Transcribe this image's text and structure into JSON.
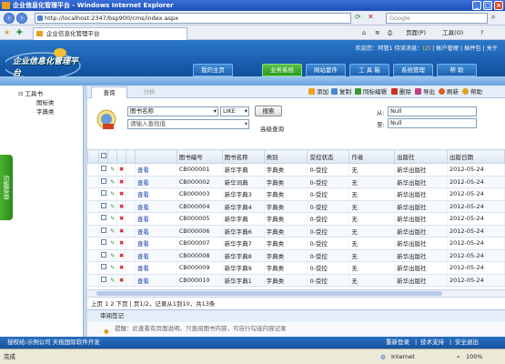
{
  "window": {
    "title": "企业信息化管理平台 - Windows Internet Explorer"
  },
  "browser": {
    "address": "http://localhost:2347/bsp900/cms/index.aspx",
    "search_placeholder": "Google",
    "tab_title": "企业信息化管理平台",
    "cmd_page": "页面(P)",
    "cmd_tools": "工具(O)",
    "status_left": "完成",
    "status_zone": "Internet",
    "zoom": "100%"
  },
  "app": {
    "logo_text": "企业信息化管理平台",
    "welcome": "欢迎您：阿管1 待读消息：",
    "welcome_count": "(2)",
    "links": [
      "账户管理",
      "插件包",
      "关于"
    ],
    "nav": [
      "我的主页",
      "业务系统",
      "网站套件",
      "工 具 箱",
      "系统管理",
      "帮 助"
    ],
    "nav_active": "业务系统"
  },
  "sidebar": {
    "root": "工具书",
    "children": [
      "图标类",
      "字典类"
    ],
    "tab_label": "功能菜单"
  },
  "query": {
    "tabs": [
      "查询",
      "分析"
    ],
    "tools": [
      "添加",
      "复制",
      "同标编辑",
      "删除",
      "导出",
      "刷新",
      "帮助"
    ],
    "field_select": "图书名称",
    "op_select": "LIKE",
    "search_button": "搜索",
    "keyword_placeholder": "请输入查找值",
    "advanced": "高级查询",
    "from_label": "从:",
    "from_value": "Null",
    "to_label": "至:",
    "to_value": "Null"
  },
  "table": {
    "columns": [
      "",
      "",
      "",
      "",
      "图书编号",
      "图书名称",
      "类别",
      "受控状态",
      "作者",
      "出版社",
      "出版日期"
    ],
    "view_label": "查看",
    "rows": [
      [
        "CB000001",
        "新华字典",
        "字典类",
        "0-受控",
        "无",
        "新华出版社",
        "2012-05-24"
      ],
      [
        "CB000002",
        "新华词典",
        "字典类",
        "0-受控",
        "无",
        "新华出版社",
        "2012-05-24"
      ],
      [
        "CB000003",
        "新华字典3",
        "字典类",
        "0-受控",
        "无",
        "新华出版社",
        "2012-05-24"
      ],
      [
        "CB000004",
        "新华字典4",
        "字典类",
        "0-受控",
        "无",
        "新华出版社",
        "2012-05-24"
      ],
      [
        "CB000005",
        "新华字典",
        "字典类",
        "0-受控",
        "无",
        "新华出版社",
        "2012-05-24"
      ],
      [
        "CB000006",
        "新华字典6",
        "字典类",
        "0-受控",
        "无",
        "新华出版社",
        "2012-05-24"
      ],
      [
        "CB000007",
        "新华字典7",
        "字典类",
        "0-受控",
        "无",
        "新华出版社",
        "2012-05-24"
      ],
      [
        "CB000008",
        "新华字典8",
        "字典类",
        "0-受控",
        "无",
        "新华出版社",
        "2012-05-24"
      ],
      [
        "CB000009",
        "新华字典9",
        "字典类",
        "0-受控",
        "无",
        "新华出版社",
        "2012-05-24"
      ],
      [
        "CB000010",
        "新华字典1",
        "字典类",
        "0-受控",
        "无",
        "新华出版社",
        "2012-05-24"
      ]
    ]
  },
  "pager": {
    "text": "上页 1 2 下页 | 页1/2，记录从1到10，共13条"
  },
  "subpanel": {
    "tab": "审阅签记",
    "hint": "提醒：此查看有页面说明。只查阅图书内容，可自行勾选内容记录"
  },
  "footer": {
    "left": "授权给:示例公司 天极国际软件开发",
    "links": [
      "重新登录",
      "技术支持",
      "安全退出"
    ]
  }
}
